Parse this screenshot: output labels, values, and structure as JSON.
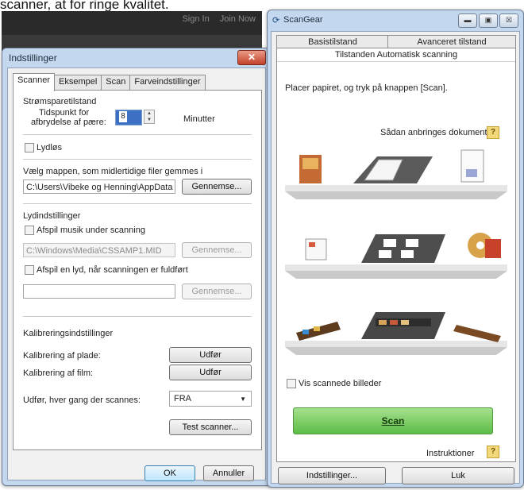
{
  "caption": "scanner, at for ringe kvalitet.",
  "website": {
    "links": [
      "Sign In",
      "Join Now"
    ]
  },
  "settings": {
    "title": "Indstillinger",
    "tabs": [
      "Scanner",
      "Eksempel",
      "Scan",
      "Farveindstillinger"
    ],
    "power_save_heading": "Strømsparetilstand",
    "timeout_label_line1": "Tidspunkt for",
    "timeout_label_line2": "afbrydelse af pære:",
    "timeout_value": "8",
    "timeout_unit": "Minutter",
    "silent_label": "Lydløs",
    "temp_folder_label": "Vælg mappen, som midlertidige filer gemmes i",
    "temp_folder_path": "C:\\Users\\Vibeke og Henning\\AppData",
    "browse": "Gennemse...",
    "sound_heading": "Lydindstillinger",
    "play_music_label": "Afspil musik under scanning",
    "music_path": "C:\\Windows\\Media\\CSSAMP1.MID",
    "play_sound_label": "Afspil en lyd, når scanningen er fuldført",
    "sound_path": "",
    "calibration_heading": "Kalibreringsindstillinger",
    "calib_plate_label": "Kalibrering af plade:",
    "calib_film_label": "Kalibrering af film:",
    "execute": "Udfør",
    "run_each_label": "Udfør, hver gang der scannes:",
    "run_each_value": "FRA",
    "test_scanner": "Test scanner...",
    "ok": "OK",
    "cancel": "Annuller"
  },
  "scangear": {
    "title": "ScanGear",
    "tab_basic": "Basistilstand",
    "tab_advanced": "Avanceret tilstand",
    "tab_auto": "Tilstanden Automatisk scanning",
    "instruction": "Placer papiret, og tryk på knappen [Scan].",
    "placement_label": "Sådan anbringes dokumenter",
    "show_images_label": "Vis scannede billeder",
    "scan_button": "Scan",
    "instructions_label": "Instruktioner",
    "preferences_button": "Indstillinger...",
    "close_button": "Luk"
  }
}
